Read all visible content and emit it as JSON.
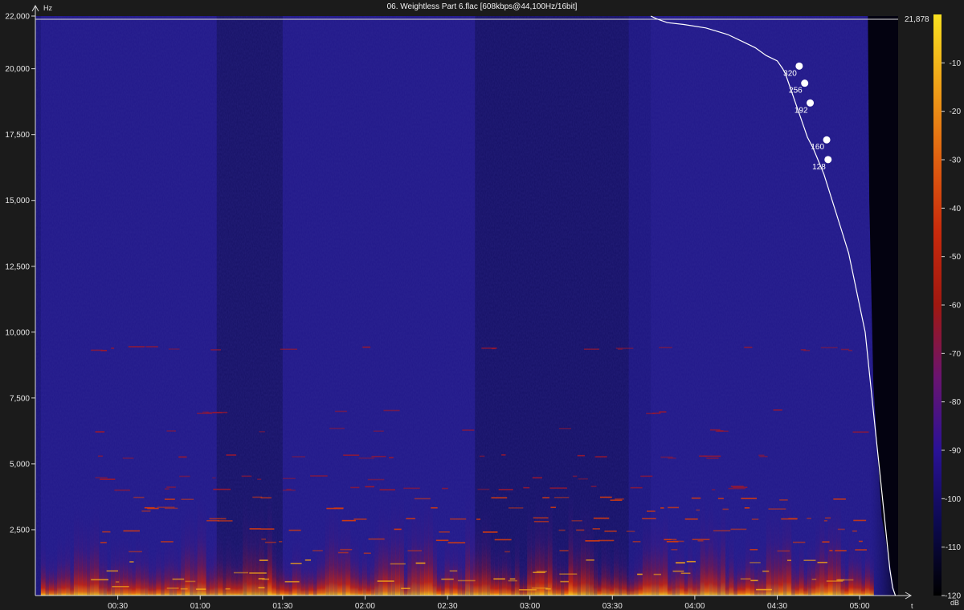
{
  "window": {
    "title": "06. Weightless Part 6.flac [608kbps@44,100Hz/16bit]"
  },
  "chart_data": {
    "type": "heatmap",
    "title": "06. Weightless Part 6.flac [608kbps@44,100Hz/16bit]",
    "xlabel": "t",
    "ylabel": "Hz",
    "xlim_seconds": [
      0,
      314
    ],
    "ylim": [
      0,
      22000
    ],
    "x_tick_labels": [
      "00:30",
      "01:00",
      "01:30",
      "02:00",
      "02:30",
      "03:00",
      "03:30",
      "04:00",
      "04:30",
      "05:00"
    ],
    "x_tick_seconds": [
      30,
      60,
      90,
      120,
      150,
      180,
      210,
      240,
      270,
      300
    ],
    "y_tick_labels": [
      "2,500",
      "5,000",
      "7,500",
      "10,000",
      "12,500",
      "15,000",
      "17,500",
      "20,000",
      "22,000"
    ],
    "y_tick_values": [
      2500,
      5000,
      7500,
      10000,
      12500,
      15000,
      17500,
      20000,
      22000
    ],
    "reference_line": {
      "label": "21,878",
      "value": 21878
    },
    "colorbar": {
      "label": "dB",
      "range": [
        -120,
        0
      ],
      "tick_labels": [
        "-10",
        "-20",
        "-30",
        "-40",
        "-50",
        "-60",
        "-70",
        "-80",
        "-90",
        "-100",
        "-110",
        "-120"
      ],
      "tick_values": [
        -10,
        -20,
        -30,
        -40,
        -50,
        -60,
        -70,
        -80,
        -90,
        -100,
        -110,
        -120
      ],
      "stops": [
        "#000000",
        "#0c0a50",
        "#2a1296",
        "#6a1470",
        "#a01810",
        "#c82a0c",
        "#e06010",
        "#f0a018",
        "#f8e020"
      ]
    },
    "cutoff_curve": {
      "x_seconds": [
        224,
        226,
        230,
        236,
        244,
        252,
        258,
        262,
        266,
        270,
        272,
        273,
        274,
        275,
        276,
        277,
        278,
        279,
        280,
        281,
        283,
        285,
        287,
        290,
        293,
        296,
        298,
        300,
        302,
        303,
        304,
        305,
        306,
        307,
        308,
        309,
        310,
        311,
        312,
        313
      ],
      "y_hz": [
        22000,
        21900,
        21750,
        21680,
        21550,
        21300,
        21000,
        20800,
        20500,
        20300,
        20000,
        19800,
        19500,
        19200,
        18900,
        18600,
        18300,
        18000,
        17700,
        17400,
        17000,
        16500,
        16000,
        15000,
        14000,
        13000,
        12000,
        11000,
        10000,
        9000,
        8000,
        7000,
        6000,
        5000,
        4000,
        3000,
        2000,
        1000,
        300,
        0
      ]
    },
    "bitrate_markers": [
      {
        "label": "320",
        "time": 278,
        "freq": 20100
      },
      {
        "label": "256",
        "time": 280,
        "freq": 19450
      },
      {
        "label": "192",
        "time": 282,
        "freq": 18700
      },
      {
        "label": "160",
        "time": 288,
        "freq": 17300
      },
      {
        "label": "128",
        "time": 288.5,
        "freq": 16550
      }
    ],
    "colors": {
      "background": "#1b1b1b",
      "base_plot": "#22198a",
      "axis": "#d8d8d8",
      "curve": "#ffffff"
    }
  }
}
